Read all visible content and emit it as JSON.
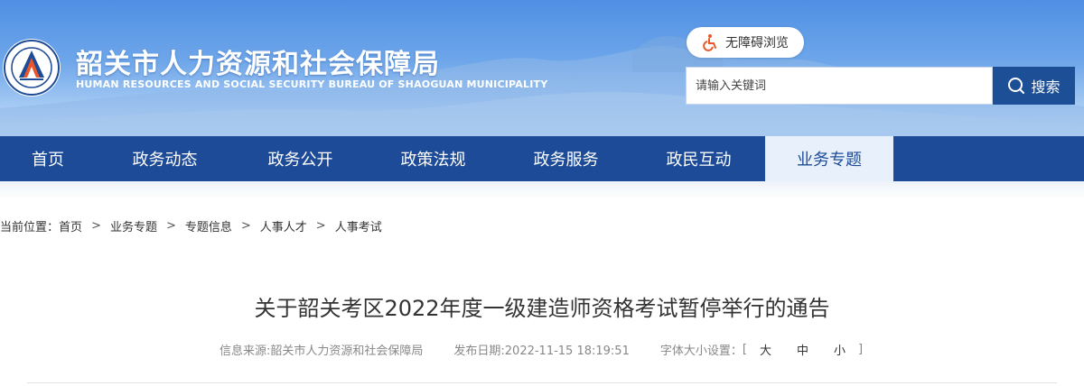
{
  "header": {
    "title_cn": "韶关市人力资源和社会保障局",
    "title_en": "HUMAN RESOURCES AND SOCIAL SECURITY BUREAU OF SHAOGUAN MUNICIPALITY",
    "logo_icon": "bureau-emblem-icon",
    "accessibility_label": "无障碍浏览",
    "accessibility_icon": "wheelchair-icon",
    "search": {
      "placeholder": "请输入关键词",
      "button_label": "搜索",
      "button_icon": "search-icon"
    }
  },
  "nav": {
    "items": [
      {
        "label": "首页"
      },
      {
        "label": "政务动态"
      },
      {
        "label": "政务公开"
      },
      {
        "label": "政策法规"
      },
      {
        "label": "政务服务"
      },
      {
        "label": "政民互动"
      },
      {
        "label": "业务专题",
        "active": true
      }
    ]
  },
  "breadcrumb": {
    "prefix": "当前位置：",
    "items": [
      "首页",
      "业务专题",
      "专题信息",
      "人事人才",
      "人事考试"
    ],
    "separator": ">"
  },
  "article": {
    "title": "关于韶关考区2022年度一级建造师资格考试暂停举行的通告",
    "source": "信息来源:韶关市人力资源和社会保障局",
    "published": "发布日期:2022-11-15 18:19:51",
    "font_size_label": "字体大小设置：",
    "font_size_options": [
      "大",
      "中",
      "小"
    ],
    "bracket_open": "[",
    "bracket_close": "]"
  },
  "colors": {
    "nav_bg": "#1d4b97",
    "nav_active_bg": "#e8f0fb",
    "search_button_bg": "#1d4f96",
    "accessibility_icon": "#e8562a"
  }
}
